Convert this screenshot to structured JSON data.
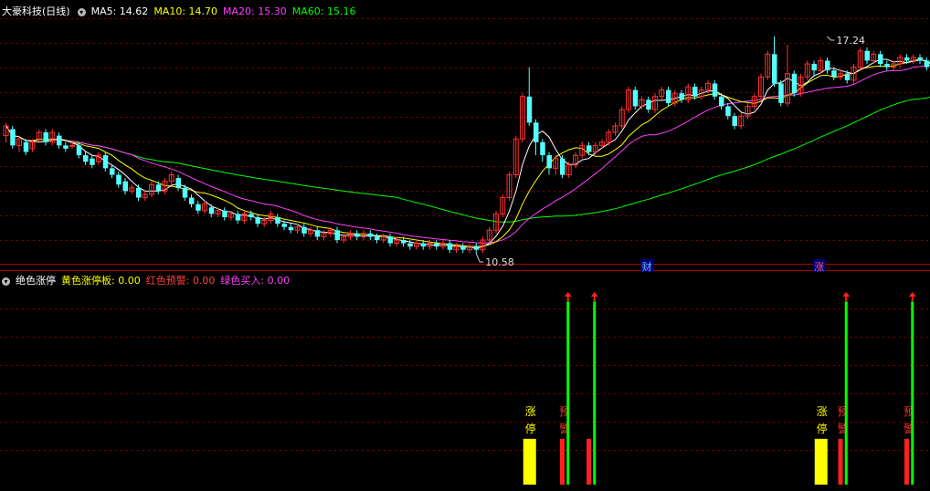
{
  "header": {
    "stock_title": "大豪科技(日线)",
    "ma5": "MA5: 14.62",
    "ma10": "MA10: 14.70",
    "ma20": "MA20: 15.30",
    "ma60": "MA60: 15.16"
  },
  "indicator_header": {
    "name": "绝色涨停",
    "yellow": "黄色涨停板: 0.00",
    "red": "红色预警: 0.00",
    "green": "绿色买入: 0.00"
  },
  "colors": {
    "up": "#ff3030",
    "down": "#54ffff",
    "ma5": "#ffffff",
    "ma10": "#ffff00",
    "ma20": "#ff40ff",
    "ma60": "#00ff00",
    "grid": "#8b0000"
  },
  "chart_data": [
    {
      "type": "candlestick",
      "annotations": [
        {
          "label": "17.24",
          "value": 17.24,
          "index": 124
        },
        {
          "label": "10.58",
          "value": 10.58,
          "index": 71
        }
      ],
      "markers": [
        {
          "label": "财",
          "index": 97
        },
        {
          "label": "涨",
          "index": 123
        }
      ],
      "ylim": [
        10.3,
        17.8
      ],
      "candles": [
        [
          14.2,
          14.5,
          14.6,
          14.0
        ],
        [
          14.4,
          13.9,
          14.5,
          13.8
        ],
        [
          13.9,
          14.1,
          14.2,
          13.7
        ],
        [
          14.0,
          13.7,
          14.1,
          13.6
        ],
        [
          13.8,
          14.0,
          14.1,
          13.7
        ],
        [
          14.1,
          14.3,
          14.4,
          14.0
        ],
        [
          14.3,
          14.0,
          14.4,
          13.9
        ],
        [
          14.0,
          14.3,
          14.4,
          13.9
        ],
        [
          14.2,
          13.9,
          14.3,
          13.8
        ],
        [
          13.9,
          13.8,
          14.0,
          13.7
        ],
        [
          13.9,
          13.9,
          14.0,
          13.8
        ],
        [
          13.9,
          13.6,
          14.0,
          13.5
        ],
        [
          13.6,
          13.4,
          13.7,
          13.3
        ],
        [
          13.5,
          13.3,
          13.6,
          13.2
        ],
        [
          13.4,
          13.6,
          13.7,
          13.3
        ],
        [
          13.6,
          13.2,
          13.7,
          13.1
        ],
        [
          13.2,
          13.0,
          13.3,
          12.9
        ],
        [
          13.0,
          12.7,
          13.1,
          12.6
        ],
        [
          12.8,
          12.5,
          12.9,
          12.4
        ],
        [
          12.5,
          12.6,
          12.7,
          12.4
        ],
        [
          12.6,
          12.3,
          12.7,
          12.2
        ],
        [
          12.3,
          12.4,
          12.5,
          12.2
        ],
        [
          12.4,
          12.7,
          12.8,
          12.3
        ],
        [
          12.7,
          12.5,
          12.8,
          12.4
        ],
        [
          12.5,
          12.8,
          12.9,
          12.4
        ],
        [
          12.8,
          13.0,
          13.1,
          12.7
        ],
        [
          12.9,
          12.6,
          13.0,
          12.5
        ],
        [
          12.6,
          12.3,
          12.7,
          12.2
        ],
        [
          12.3,
          12.1,
          12.4,
          12.0
        ],
        [
          12.1,
          11.9,
          12.2,
          11.8
        ],
        [
          11.9,
          12.1,
          12.2,
          11.8
        ],
        [
          12.0,
          11.8,
          12.1,
          11.7
        ],
        [
          11.8,
          11.9,
          12.0,
          11.7
        ],
        [
          11.9,
          11.7,
          12.0,
          11.6
        ],
        [
          11.7,
          11.8,
          11.9,
          11.6
        ],
        [
          11.8,
          11.6,
          11.9,
          11.5
        ],
        [
          11.6,
          11.8,
          11.9,
          11.5
        ],
        [
          11.8,
          11.7,
          11.9,
          11.6
        ],
        [
          11.7,
          11.5,
          11.8,
          11.4
        ],
        [
          11.5,
          11.6,
          11.7,
          11.4
        ],
        [
          11.6,
          11.8,
          11.9,
          11.5
        ],
        [
          11.7,
          11.5,
          11.8,
          11.4
        ],
        [
          11.5,
          11.4,
          11.6,
          11.3
        ],
        [
          11.4,
          11.3,
          11.5,
          11.2
        ],
        [
          11.3,
          11.4,
          11.5,
          11.2
        ],
        [
          11.4,
          11.2,
          11.5,
          11.1
        ],
        [
          11.2,
          11.3,
          11.4,
          11.1
        ],
        [
          11.3,
          11.1,
          11.4,
          11.0
        ],
        [
          11.1,
          11.2,
          11.3,
          11.0
        ],
        [
          11.2,
          11.3,
          11.4,
          11.1
        ],
        [
          11.3,
          11.0,
          11.4,
          10.9
        ],
        [
          11.0,
          11.1,
          11.2,
          10.9
        ],
        [
          11.1,
          11.2,
          11.3,
          11.0
        ],
        [
          11.2,
          11.1,
          11.3,
          11.0
        ],
        [
          11.1,
          11.2,
          11.3,
          11.0
        ],
        [
          11.2,
          11.1,
          11.3,
          11.0
        ],
        [
          11.1,
          11.0,
          11.2,
          10.9
        ],
        [
          11.0,
          11.1,
          11.2,
          10.9
        ],
        [
          11.1,
          10.9,
          11.2,
          10.8
        ],
        [
          10.9,
          11.0,
          11.1,
          10.8
        ],
        [
          11.0,
          10.9,
          11.1,
          10.8
        ],
        [
          10.9,
          10.8,
          11.0,
          10.7
        ],
        [
          10.8,
          10.9,
          11.0,
          10.7
        ],
        [
          10.9,
          10.8,
          11.0,
          10.7
        ],
        [
          10.8,
          10.9,
          11.0,
          10.7
        ],
        [
          10.9,
          10.8,
          11.0,
          10.7
        ],
        [
          10.8,
          10.9,
          11.0,
          10.7
        ],
        [
          10.9,
          10.7,
          11.0,
          10.6
        ],
        [
          10.7,
          10.8,
          10.9,
          10.6
        ],
        [
          10.8,
          10.7,
          10.9,
          10.6
        ],
        [
          10.7,
          10.8,
          10.9,
          10.6
        ],
        [
          10.8,
          10.7,
          10.9,
          10.58
        ],
        [
          10.7,
          11.0,
          11.1,
          10.6
        ],
        [
          11.0,
          11.3,
          11.4,
          10.9
        ],
        [
          11.3,
          11.8,
          11.9,
          11.2
        ],
        [
          11.8,
          12.3,
          12.4,
          11.7
        ],
        [
          12.3,
          13.0,
          13.1,
          12.2
        ],
        [
          13.0,
          14.1,
          14.2,
          12.9
        ],
        [
          14.1,
          15.4,
          15.5,
          14.0
        ],
        [
          15.4,
          14.6,
          16.3,
          14.5
        ],
        [
          14.6,
          14.0,
          14.7,
          13.6
        ],
        [
          14.0,
          13.6,
          14.1,
          13.4
        ],
        [
          13.6,
          13.2,
          13.7,
          13.0
        ],
        [
          13.2,
          13.5,
          13.6,
          13.0
        ],
        [
          13.5,
          13.0,
          13.6,
          12.9
        ],
        [
          13.0,
          13.3,
          13.4,
          12.9
        ],
        [
          13.3,
          13.6,
          13.7,
          13.2
        ],
        [
          13.6,
          13.9,
          14.0,
          13.5
        ],
        [
          13.9,
          13.7,
          14.0,
          13.6
        ],
        [
          13.7,
          13.9,
          14.0,
          13.6
        ],
        [
          13.9,
          14.0,
          14.1,
          13.8
        ],
        [
          14.0,
          14.3,
          14.4,
          13.9
        ],
        [
          14.3,
          14.5,
          14.6,
          14.2
        ],
        [
          14.5,
          15.0,
          15.1,
          14.4
        ],
        [
          15.0,
          15.6,
          15.7,
          14.9
        ],
        [
          15.6,
          15.1,
          15.7,
          15.0
        ],
        [
          15.1,
          15.3,
          15.4,
          15.0
        ],
        [
          15.3,
          15.0,
          15.4,
          14.9
        ],
        [
          15.0,
          15.4,
          15.5,
          14.9
        ],
        [
          15.4,
          15.6,
          15.7,
          15.3
        ],
        [
          15.6,
          15.2,
          15.7,
          15.1
        ],
        [
          15.2,
          15.5,
          15.6,
          15.1
        ],
        [
          15.5,
          15.3,
          15.6,
          15.2
        ],
        [
          15.3,
          15.7,
          15.8,
          15.2
        ],
        [
          15.7,
          15.4,
          15.8,
          15.3
        ],
        [
          15.4,
          15.6,
          15.7,
          15.3
        ],
        [
          15.6,
          15.8,
          15.9,
          15.5
        ],
        [
          15.8,
          15.4,
          15.9,
          15.3
        ],
        [
          15.4,
          15.1,
          15.5,
          15.0
        ],
        [
          15.1,
          14.8,
          15.2,
          14.7
        ],
        [
          14.8,
          14.5,
          14.9,
          14.4
        ],
        [
          14.5,
          14.8,
          14.9,
          14.4
        ],
        [
          14.8,
          15.1,
          15.2,
          14.7
        ],
        [
          15.1,
          15.4,
          15.5,
          15.0
        ],
        [
          15.4,
          16.0,
          16.1,
          15.3
        ],
        [
          16.0,
          16.7,
          16.8,
          15.9
        ],
        [
          16.7,
          15.8,
          17.24,
          15.7
        ],
        [
          15.8,
          15.2,
          15.9,
          15.1
        ],
        [
          15.2,
          16.1,
          17.0,
          15.1
        ],
        [
          16.1,
          15.5,
          16.2,
          15.4
        ],
        [
          15.5,
          16.0,
          16.1,
          15.4
        ],
        [
          16.0,
          16.4,
          16.5,
          15.9
        ],
        [
          16.4,
          16.2,
          16.5,
          16.0
        ],
        [
          16.2,
          16.5,
          16.6,
          16.1
        ],
        [
          16.5,
          16.2,
          16.6,
          16.1
        ],
        [
          16.2,
          16.0,
          16.3,
          15.9
        ],
        [
          16.0,
          16.1,
          16.2,
          15.9
        ],
        [
          16.1,
          15.9,
          16.2,
          15.8
        ],
        [
          15.9,
          16.3,
          16.4,
          15.8
        ],
        [
          16.3,
          16.8,
          16.9,
          16.2
        ],
        [
          16.8,
          16.5,
          16.9,
          16.4
        ],
        [
          16.5,
          16.7,
          16.8,
          16.4
        ],
        [
          16.7,
          16.4,
          16.8,
          16.3
        ],
        [
          16.4,
          16.3,
          16.5,
          16.2
        ],
        [
          16.3,
          16.4,
          16.5,
          16.2
        ],
        [
          16.4,
          16.6,
          16.7,
          16.3
        ],
        [
          16.6,
          16.5,
          16.7,
          16.4
        ],
        [
          16.5,
          16.6,
          16.7,
          16.4
        ],
        [
          16.6,
          16.5,
          16.7,
          16.4
        ],
        [
          16.5,
          16.3,
          16.6,
          16.2
        ],
        [
          16.3,
          15.8,
          16.4,
          15.7
        ],
        [
          15.8,
          15.3,
          15.9,
          15.2
        ],
        [
          15.3,
          15.0,
          15.4,
          14.9
        ],
        [
          15.0,
          14.8,
          15.1,
          14.7
        ]
      ]
    },
    {
      "type": "signal-bars",
      "bars": [
        {
          "index": 79,
          "color": "#ffff00",
          "height": 0.24,
          "label": "涨停"
        },
        {
          "index": 84,
          "color": "#ff2020",
          "height": 0.24,
          "label": "预警"
        },
        {
          "index": 85,
          "color": "#00ff00",
          "height": 0.96,
          "arrow": true
        },
        {
          "index": 88,
          "color": "#ff2020",
          "height": 0.24
        },
        {
          "index": 89,
          "color": "#00ff00",
          "height": 0.96,
          "arrow": true
        },
        {
          "index": 123,
          "color": "#ffff00",
          "height": 0.24,
          "label": "涨停"
        },
        {
          "index": 126,
          "color": "#ff2020",
          "height": 0.24,
          "label": "预警"
        },
        {
          "index": 127,
          "color": "#00ff00",
          "height": 0.96,
          "arrow": true
        },
        {
          "index": 136,
          "color": "#ff2020",
          "height": 0.24,
          "label": "预警"
        },
        {
          "index": 137,
          "color": "#00ff00",
          "height": 0.96,
          "arrow": true
        }
      ]
    }
  ]
}
